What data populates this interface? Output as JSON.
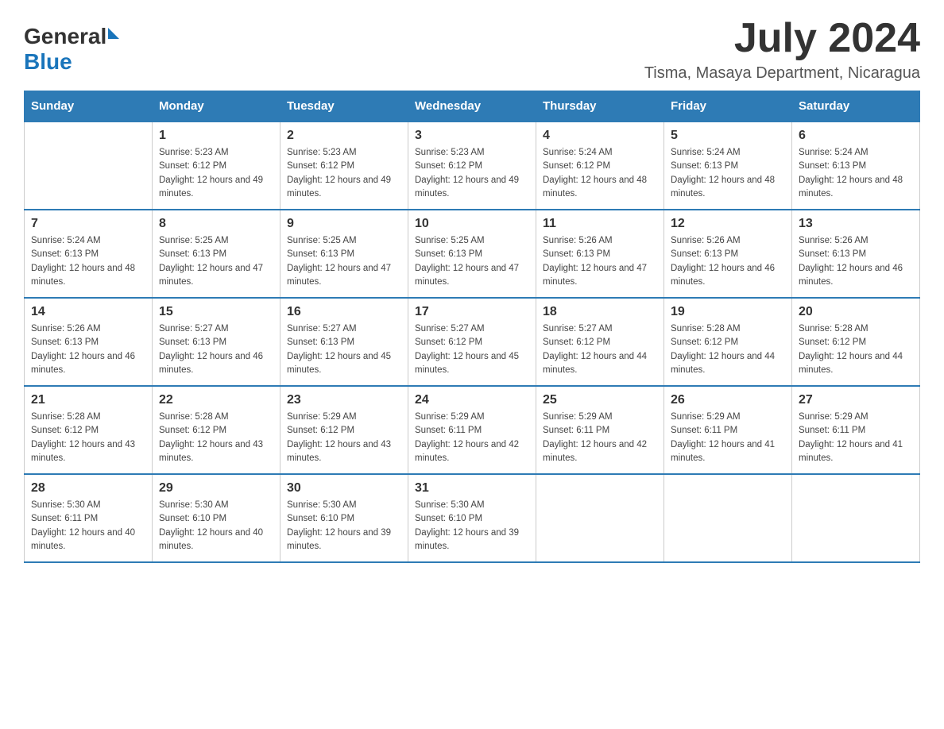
{
  "header": {
    "logo_general": "General",
    "logo_blue": "Blue",
    "month_year": "July 2024",
    "location": "Tisma, Masaya Department, Nicaragua"
  },
  "days_of_week": [
    "Sunday",
    "Monday",
    "Tuesday",
    "Wednesday",
    "Thursday",
    "Friday",
    "Saturday"
  ],
  "weeks": [
    [
      {
        "day": "",
        "sunrise": "",
        "sunset": "",
        "daylight": ""
      },
      {
        "day": "1",
        "sunrise": "Sunrise: 5:23 AM",
        "sunset": "Sunset: 6:12 PM",
        "daylight": "Daylight: 12 hours and 49 minutes."
      },
      {
        "day": "2",
        "sunrise": "Sunrise: 5:23 AM",
        "sunset": "Sunset: 6:12 PM",
        "daylight": "Daylight: 12 hours and 49 minutes."
      },
      {
        "day": "3",
        "sunrise": "Sunrise: 5:23 AM",
        "sunset": "Sunset: 6:12 PM",
        "daylight": "Daylight: 12 hours and 49 minutes."
      },
      {
        "day": "4",
        "sunrise": "Sunrise: 5:24 AM",
        "sunset": "Sunset: 6:12 PM",
        "daylight": "Daylight: 12 hours and 48 minutes."
      },
      {
        "day": "5",
        "sunrise": "Sunrise: 5:24 AM",
        "sunset": "Sunset: 6:13 PM",
        "daylight": "Daylight: 12 hours and 48 minutes."
      },
      {
        "day": "6",
        "sunrise": "Sunrise: 5:24 AM",
        "sunset": "Sunset: 6:13 PM",
        "daylight": "Daylight: 12 hours and 48 minutes."
      }
    ],
    [
      {
        "day": "7",
        "sunrise": "Sunrise: 5:24 AM",
        "sunset": "Sunset: 6:13 PM",
        "daylight": "Daylight: 12 hours and 48 minutes."
      },
      {
        "day": "8",
        "sunrise": "Sunrise: 5:25 AM",
        "sunset": "Sunset: 6:13 PM",
        "daylight": "Daylight: 12 hours and 47 minutes."
      },
      {
        "day": "9",
        "sunrise": "Sunrise: 5:25 AM",
        "sunset": "Sunset: 6:13 PM",
        "daylight": "Daylight: 12 hours and 47 minutes."
      },
      {
        "day": "10",
        "sunrise": "Sunrise: 5:25 AM",
        "sunset": "Sunset: 6:13 PM",
        "daylight": "Daylight: 12 hours and 47 minutes."
      },
      {
        "day": "11",
        "sunrise": "Sunrise: 5:26 AM",
        "sunset": "Sunset: 6:13 PM",
        "daylight": "Daylight: 12 hours and 47 minutes."
      },
      {
        "day": "12",
        "sunrise": "Sunrise: 5:26 AM",
        "sunset": "Sunset: 6:13 PM",
        "daylight": "Daylight: 12 hours and 46 minutes."
      },
      {
        "day": "13",
        "sunrise": "Sunrise: 5:26 AM",
        "sunset": "Sunset: 6:13 PM",
        "daylight": "Daylight: 12 hours and 46 minutes."
      }
    ],
    [
      {
        "day": "14",
        "sunrise": "Sunrise: 5:26 AM",
        "sunset": "Sunset: 6:13 PM",
        "daylight": "Daylight: 12 hours and 46 minutes."
      },
      {
        "day": "15",
        "sunrise": "Sunrise: 5:27 AM",
        "sunset": "Sunset: 6:13 PM",
        "daylight": "Daylight: 12 hours and 46 minutes."
      },
      {
        "day": "16",
        "sunrise": "Sunrise: 5:27 AM",
        "sunset": "Sunset: 6:13 PM",
        "daylight": "Daylight: 12 hours and 45 minutes."
      },
      {
        "day": "17",
        "sunrise": "Sunrise: 5:27 AM",
        "sunset": "Sunset: 6:12 PM",
        "daylight": "Daylight: 12 hours and 45 minutes."
      },
      {
        "day": "18",
        "sunrise": "Sunrise: 5:27 AM",
        "sunset": "Sunset: 6:12 PM",
        "daylight": "Daylight: 12 hours and 44 minutes."
      },
      {
        "day": "19",
        "sunrise": "Sunrise: 5:28 AM",
        "sunset": "Sunset: 6:12 PM",
        "daylight": "Daylight: 12 hours and 44 minutes."
      },
      {
        "day": "20",
        "sunrise": "Sunrise: 5:28 AM",
        "sunset": "Sunset: 6:12 PM",
        "daylight": "Daylight: 12 hours and 44 minutes."
      }
    ],
    [
      {
        "day": "21",
        "sunrise": "Sunrise: 5:28 AM",
        "sunset": "Sunset: 6:12 PM",
        "daylight": "Daylight: 12 hours and 43 minutes."
      },
      {
        "day": "22",
        "sunrise": "Sunrise: 5:28 AM",
        "sunset": "Sunset: 6:12 PM",
        "daylight": "Daylight: 12 hours and 43 minutes."
      },
      {
        "day": "23",
        "sunrise": "Sunrise: 5:29 AM",
        "sunset": "Sunset: 6:12 PM",
        "daylight": "Daylight: 12 hours and 43 minutes."
      },
      {
        "day": "24",
        "sunrise": "Sunrise: 5:29 AM",
        "sunset": "Sunset: 6:11 PM",
        "daylight": "Daylight: 12 hours and 42 minutes."
      },
      {
        "day": "25",
        "sunrise": "Sunrise: 5:29 AM",
        "sunset": "Sunset: 6:11 PM",
        "daylight": "Daylight: 12 hours and 42 minutes."
      },
      {
        "day": "26",
        "sunrise": "Sunrise: 5:29 AM",
        "sunset": "Sunset: 6:11 PM",
        "daylight": "Daylight: 12 hours and 41 minutes."
      },
      {
        "day": "27",
        "sunrise": "Sunrise: 5:29 AM",
        "sunset": "Sunset: 6:11 PM",
        "daylight": "Daylight: 12 hours and 41 minutes."
      }
    ],
    [
      {
        "day": "28",
        "sunrise": "Sunrise: 5:30 AM",
        "sunset": "Sunset: 6:11 PM",
        "daylight": "Daylight: 12 hours and 40 minutes."
      },
      {
        "day": "29",
        "sunrise": "Sunrise: 5:30 AM",
        "sunset": "Sunset: 6:10 PM",
        "daylight": "Daylight: 12 hours and 40 minutes."
      },
      {
        "day": "30",
        "sunrise": "Sunrise: 5:30 AM",
        "sunset": "Sunset: 6:10 PM",
        "daylight": "Daylight: 12 hours and 39 minutes."
      },
      {
        "day": "31",
        "sunrise": "Sunrise: 5:30 AM",
        "sunset": "Sunset: 6:10 PM",
        "daylight": "Daylight: 12 hours and 39 minutes."
      },
      {
        "day": "",
        "sunrise": "",
        "sunset": "",
        "daylight": ""
      },
      {
        "day": "",
        "sunrise": "",
        "sunset": "",
        "daylight": ""
      },
      {
        "day": "",
        "sunrise": "",
        "sunset": "",
        "daylight": ""
      }
    ]
  ]
}
